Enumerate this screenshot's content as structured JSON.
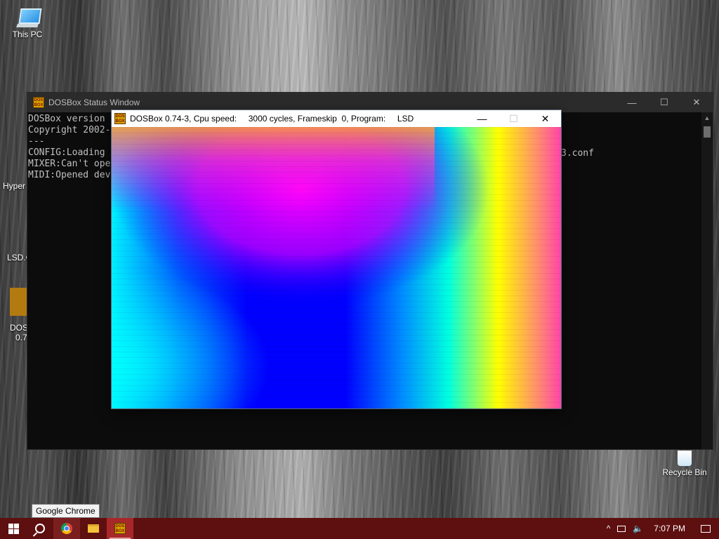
{
  "desktop": {
    "icons": [
      {
        "label": "This PC"
      },
      {
        "label": "Hyper"
      },
      {
        "label": "LSD.C"
      },
      {
        "label": "DOS",
        "label2": "0.7"
      },
      {
        "label": "Recycle Bin"
      }
    ]
  },
  "status_window": {
    "title": "DOSBox Status Window",
    "app_icon_text": "DOS BOX",
    "controls": {
      "minimize": "—",
      "maximize": "☐",
      "close": "✕"
    },
    "console_lines": [
      "DOSBox version",
      "Copyright 2002-",
      "---",
      "CONFIG:Loading",
      "MIXER:Can't ope",
      "MIDI:Opened dev"
    ],
    "console_tail": "3.conf"
  },
  "dosbox_window": {
    "title": "DOSBox 0.74-3, Cpu speed:     3000 cycles, Frameskip  0, Program:     LSD",
    "app_icon_text": "DOS BOX",
    "controls": {
      "minimize": "—",
      "maximize": "☐",
      "close": "✕"
    },
    "screen_palette": {
      "blue": "#0000ff",
      "magenta": "#ff00ff",
      "cyan": "#00ffff",
      "yellow": "#ffff00",
      "pink": "#ff44aa",
      "orange": "#ffb040"
    }
  },
  "tooltip": {
    "text": "Google Chrome"
  },
  "taskbar": {
    "color": "#5e0f10",
    "buttons": [
      {
        "name": "start",
        "icon": "windows-logo-icon"
      },
      {
        "name": "search",
        "icon": "search-icon"
      },
      {
        "name": "chrome",
        "icon": "chrome-icon"
      },
      {
        "name": "file-explorer",
        "icon": "folder-icon"
      },
      {
        "name": "dosbox",
        "icon": "dosbox-icon",
        "icon_text": "DOS BOX"
      }
    ],
    "tray": {
      "chevron": "^",
      "clock": "7:07 PM",
      "notification_icon": "action-center-icon"
    }
  }
}
